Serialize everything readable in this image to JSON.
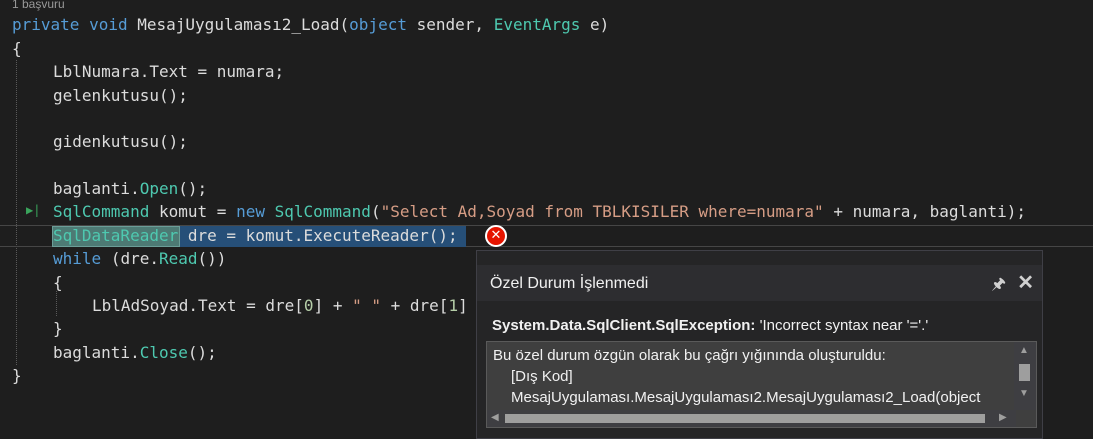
{
  "codelens": "1 başvuru",
  "code": {
    "line1": {
      "kw1": "private",
      "kw2": "void",
      "name": "MesajUygulaması2_Load(",
      "kw3": "object",
      "p1": "sender,",
      "type1": "EventArgs",
      "p2": "e)"
    },
    "open_brace": "{",
    "l_lblnumara": "LblNumara.Text = numara;",
    "l_gelen": "gelenkutusu();",
    "l_giden": "gidenkutusu();",
    "l_open_a": "baglanti.",
    "l_open_b": "Open",
    "l_open_c": "();",
    "l_cmd": {
      "type1": "SqlCommand",
      "var": "komut",
      "eq": "=",
      "kw": "new",
      "type2": "SqlCommand",
      "lp": "(",
      "str": "\"Select Ad,Soyad from TBLKISILER where=numara\"",
      "rest": "+ numara, baglanti);"
    },
    "l_reader": {
      "type": "SqlDataReader",
      "rest": "dre = komut.ExecuteReader();"
    },
    "l_while": {
      "kw": "while",
      "a": "(dre.",
      "b": "Read",
      "c": "())"
    },
    "inner_open": "{",
    "l_lbladsoyad": {
      "a": "LblAdSoyad.Text = dre[",
      "n0": "0",
      "b": "] + ",
      "str": "\" \"",
      "c": " + dre[",
      "n1": "1",
      "d": "]"
    },
    "inner_close": "}",
    "l_close_a": "baglanti.",
    "l_close_b": "Close",
    "l_close_c": "();",
    "close_brace": "}"
  },
  "popup": {
    "title": "Özel Durum İşlenmedi",
    "pin_icon": "pin-icon",
    "close_icon": "close-icon",
    "exception_type": "System.Data.SqlClient.SqlException:",
    "exception_message": "'Incorrect syntax near '='.'",
    "details": [
      "Bu özel durum özgün olarak bu çağrı yığınında oluşturuldu:",
      "[Dış Kod]",
      "MesajUygulaması.MesajUygulaması2.MesajUygulaması2_Load(object"
    ]
  },
  "colors": {
    "keyword": "#569cd6",
    "type": "#4ec9b0",
    "string": "#d69d85",
    "error": "#e51400",
    "background": "#1e1e1e"
  }
}
